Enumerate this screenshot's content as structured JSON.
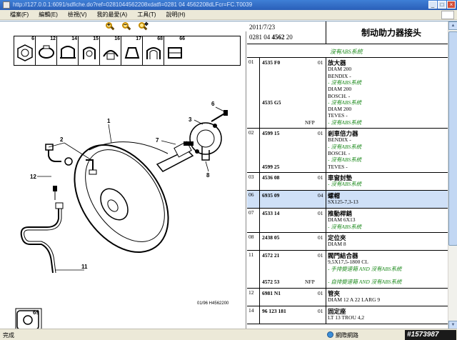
{
  "titlebar": {
    "url": "http://127.0.0.1:6091/sdfiche.do?ref=0281044562208xdatfi=0281 04 4562208dLFcr=FC.T0039"
  },
  "menu": {
    "items": [
      "檔案(F)",
      "編輯(E)",
      "檢視(V)",
      "我的最愛(A)",
      "工具(T)",
      "說明(H)"
    ]
  },
  "thumbs": [
    "6",
    "12",
    "14",
    "15",
    "16",
    "17",
    "68",
    "66"
  ],
  "diagram": {
    "callouts": [
      "1",
      "2",
      "3",
      "6",
      "7",
      "8",
      "12",
      "11",
      "69"
    ],
    "caption": "01/96  H4562200"
  },
  "header": {
    "date": "2011/7/23",
    "ref_prefix": "0281 04 ",
    "ref_bold": "4562",
    "ref_suffix": " 20",
    "title": "制动助力器接头"
  },
  "subheader": "沒有ABS系統",
  "rows": [
    {
      "idx": "01",
      "qty": "01",
      "items": [
        "4535 F0",
        "4535 G5"
      ],
      "nfp": "NFP",
      "lines": [
        {
          "t": "放大器",
          "s": "name"
        },
        {
          "t": "DIAM 200",
          "s": ""
        },
        {
          "t": "BENDIX -",
          "s": ""
        },
        {
          "t": "- 沒有ABS系統",
          "s": "green"
        },
        {
          "t": "DIAM 200",
          "s": ""
        },
        {
          "t": "BOSCH. -",
          "s": ""
        },
        {
          "t": "- 沒有ABS系統",
          "s": "green"
        },
        {
          "t": "DIAM 200",
          "s": ""
        },
        {
          "t": "TEVES -",
          "s": ""
        },
        {
          "t": "- 沒有ABS系統",
          "s": "green"
        }
      ]
    },
    {
      "idx": "02",
      "qty": "01",
      "items": [
        "4599 15",
        "4599 25"
      ],
      "lines": [
        {
          "t": "剎車倍力器",
          "s": "name"
        },
        {
          "t": "BENDIX -",
          "s": ""
        },
        {
          "t": "- 沒有ABS系統",
          "s": "green"
        },
        {
          "t": "BOSCH. -",
          "s": ""
        },
        {
          "t": "- 沒有ABS系統",
          "s": "green"
        },
        {
          "t": "TEVES -",
          "s": ""
        }
      ]
    },
    {
      "idx": "03",
      "qty": "01",
      "items": [
        "4536 08"
      ],
      "lines": [
        {
          "t": "車窗封墊",
          "s": "name"
        },
        {
          "t": "- 沒有ABS系統",
          "s": "green"
        }
      ]
    },
    {
      "idx": "06",
      "qty": "04",
      "items": [
        "6935 09"
      ],
      "selected": true,
      "lines": [
        {
          "t": "螺帽",
          "s": "name"
        },
        {
          "t": "SX125-7,3-13",
          "s": ""
        }
      ]
    },
    {
      "idx": "07",
      "qty": "01",
      "items": [
        "4533 14"
      ],
      "lines": [
        {
          "t": "推動桿銷",
          "s": "name"
        },
        {
          "t": "DIAM 6X13",
          "s": ""
        },
        {
          "t": "- 沒有ABS系統",
          "s": "green"
        }
      ]
    },
    {
      "idx": "08",
      "qty": "01",
      "items": [
        "2438 05"
      ],
      "lines": [
        {
          "t": "定位夾",
          "s": "name"
        },
        {
          "t": "DIAM 8",
          "s": ""
        }
      ]
    },
    {
      "idx": "11",
      "qty": "01",
      "items": [
        "4572 21",
        "4572 53"
      ],
      "nfp": "NFP",
      "lines": [
        {
          "t": "閥門結合器",
          "s": "name"
        },
        {
          "t": "9,5X17,5-1800 CL",
          "s": ""
        },
        {
          "t": "- 手排變速箱 AND 沒有ABS系統",
          "s": "green"
        },
        {
          "t": "",
          "s": ""
        },
        {
          "t": "- 自排變速箱 AND 沒有ABS系統",
          "s": "green"
        }
      ]
    },
    {
      "idx": "12",
      "qty": "01",
      "items": [
        "6981 N1"
      ],
      "lines": [
        {
          "t": "管夾",
          "s": "name"
        },
        {
          "t": "DIAM 12 A 22 LARG 9",
          "s": ""
        }
      ]
    },
    {
      "idx": "14",
      "qty": "01",
      "items": [
        "96 123 181"
      ],
      "lines": [
        {
          "t": "固定座",
          "s": "name"
        },
        {
          "t": "LT 13 TROU 4,2",
          "s": ""
        }
      ]
    }
  ],
  "status": {
    "done": "完成",
    "zone": "網際網路",
    "watermark": "#1573987"
  }
}
